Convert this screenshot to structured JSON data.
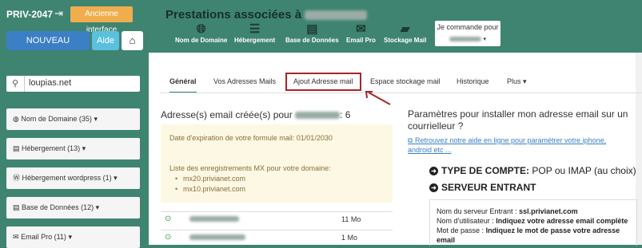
{
  "header": {
    "brand": "PRIV-2047",
    "old_interface": "Ancienne interface",
    "new_domain": "NOUVEAU DOMAINE",
    "help": "Aide",
    "title": "Prestations associées à",
    "services": [
      {
        "label": "Nom de Domaine",
        "icon": "globe-icon"
      },
      {
        "label": "Hébergement",
        "icon": "server-icon"
      },
      {
        "label": "Base de Données",
        "icon": "database-icon"
      },
      {
        "label": "Email Pro",
        "icon": "envelope-icon"
      },
      {
        "label": "Stockage Mail",
        "icon": "inbox-icon"
      }
    ],
    "order_label": "Je commande pour"
  },
  "sidebar": {
    "search_value": "loupias.net",
    "items": [
      {
        "label": "Nom de Domaine (35)",
        "icon": "globe-icon"
      },
      {
        "label": "Hébergement (13)",
        "icon": "server-icon"
      },
      {
        "label": "Hébergement wordpress (1)",
        "icon": "wordpress-icon"
      },
      {
        "label": "Base de Données (12)",
        "icon": "database-icon"
      },
      {
        "label": "Email Pro (11)",
        "icon": "envelope-icon"
      }
    ]
  },
  "tabs": [
    "Général",
    "Vos Adresses Mails",
    "Ajout Adresse mail",
    "Espace stockage mail",
    "Historique",
    "Plus"
  ],
  "content": {
    "created_prefix": "Adresse(s) email créée(s) pour",
    "created_count": ": 6",
    "expiration": "Date d'expiration de votre formule mail: 01/01/2030",
    "mx_title": "Liste des enregistrements MX pour votre domaine:",
    "mx": [
      "mx20.privianet.com",
      "mx10.privianet.com"
    ],
    "rows": [
      {
        "size": "11 Mo"
      },
      {
        "size": "1 Mo"
      }
    ]
  },
  "right": {
    "heading": "Paramètres pour installer mon adresse email sur un courrielleur ?",
    "link": "Retrouvez notre aide en ligne pour paramétrer votre iphone, android etc ...",
    "account_type_label": "TYPE DE COMPTE:",
    "account_type_value": "POP ou IMAP (au choix)",
    "incoming_label": "SERVEUR ENTRANT",
    "server_name_label": "Nom du serveur Entrant :",
    "server_name_value": "ssl.privianet.com",
    "username_label": "Nom d'utilisateur :",
    "username_value": "Indiquez votre adresse email complète",
    "password_label": "Mot de passe :",
    "password_value": "Indiquez le mot de passe votre adresse email"
  },
  "colors": {
    "brand_green": "#3f8471",
    "primary_blue": "#3b7fc4",
    "info_cyan": "#5bc0de",
    "warning_orange": "#f0ad4e",
    "highlight_red": "#a6262a"
  }
}
